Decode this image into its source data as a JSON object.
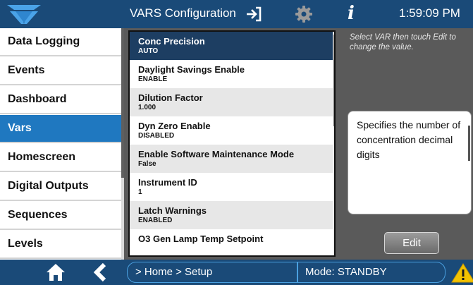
{
  "header": {
    "title": "VARS Configuration",
    "time": "1:59:09 PM",
    "info_glyph": "i",
    "icons": [
      "teledyne-logo",
      "exit-icon",
      "gear-icon",
      "info-icon"
    ]
  },
  "sidebar": {
    "items": [
      {
        "label": "Data Logging",
        "active": false
      },
      {
        "label": "Events",
        "active": false
      },
      {
        "label": "Dashboard",
        "active": false
      },
      {
        "label": "Vars",
        "active": true
      },
      {
        "label": "Homescreen",
        "active": false
      },
      {
        "label": "Digital Outputs",
        "active": false
      },
      {
        "label": "Sequences",
        "active": false
      },
      {
        "label": "Levels",
        "active": false
      }
    ]
  },
  "vars": {
    "items": [
      {
        "name": "Conc Precision",
        "value": "AUTO",
        "selected": true
      },
      {
        "name": "Daylight Savings Enable",
        "value": "ENABLE",
        "selected": false
      },
      {
        "name": "Dilution Factor",
        "value": "1.000",
        "selected": false
      },
      {
        "name": "Dyn Zero Enable",
        "value": "DISABLED",
        "selected": false
      },
      {
        "name": "Enable Software Maintenance Mode",
        "value": "False",
        "selected": false
      },
      {
        "name": "Instrument ID",
        "value": "1",
        "selected": false
      },
      {
        "name": "Latch Warnings",
        "value": "ENABLED",
        "selected": false
      },
      {
        "name": "O3 Gen Lamp Temp Setpoint",
        "value": "",
        "selected": false
      }
    ]
  },
  "panel": {
    "hint": "Select VAR then touch Edit to change the value.",
    "description": "Specifies the number of concentration decimal digits",
    "edit_label": "Edit"
  },
  "footer": {
    "breadcrumb": "> Home > Setup",
    "mode": "Mode: STANDBY",
    "icons": [
      "home-icon",
      "back-icon",
      "warning-icon"
    ]
  },
  "colors": {
    "bar": "#1a4a78",
    "active": "#1f78c0",
    "selected_row": "#1d3e62",
    "background": "#5a5a5a",
    "warning": "#f2c200"
  }
}
